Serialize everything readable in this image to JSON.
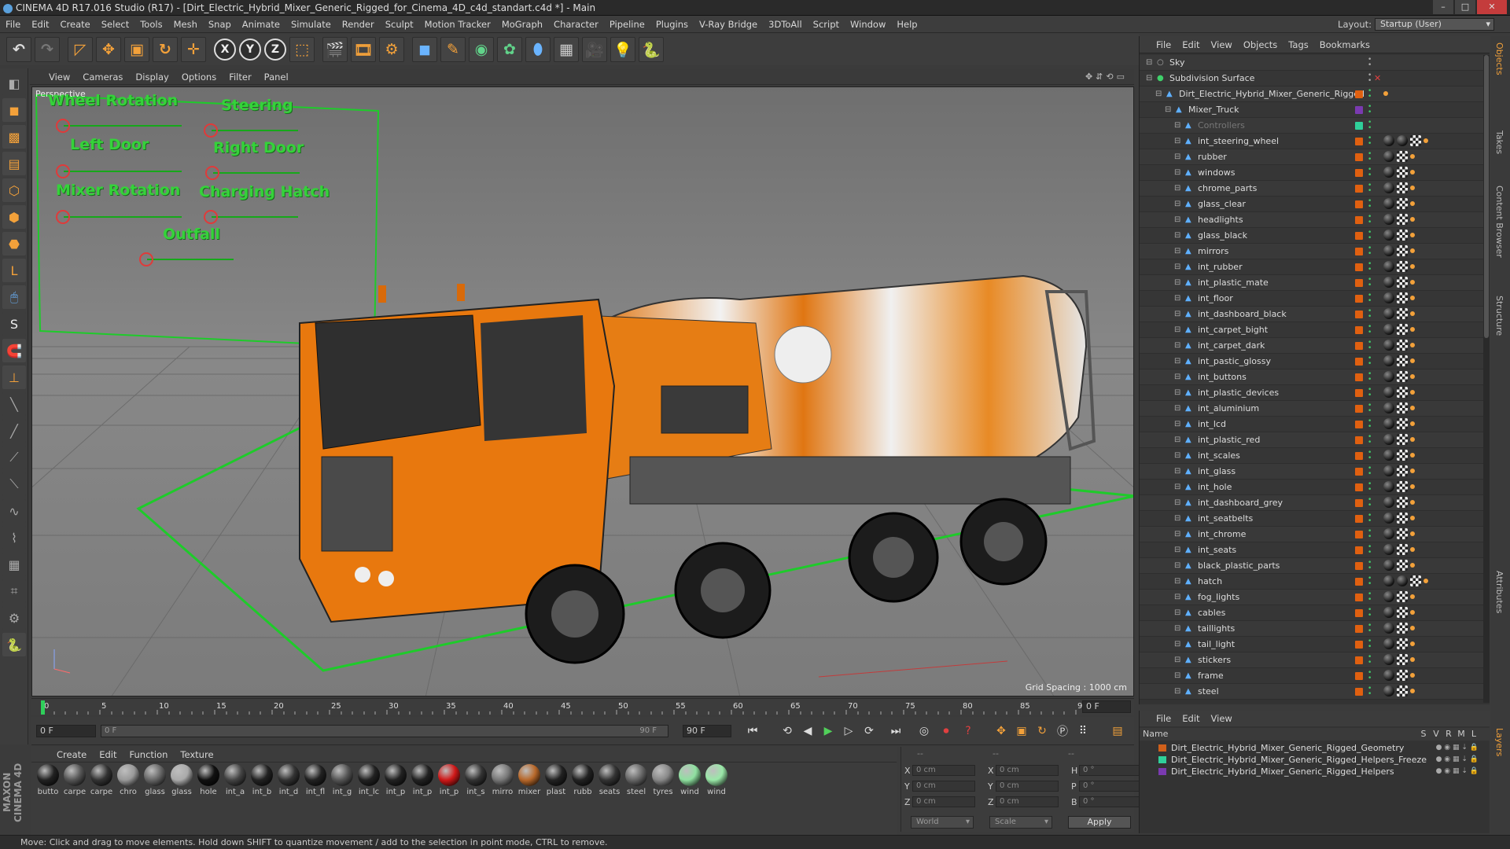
{
  "window": {
    "title": "CINEMA 4D R17.016 Studio (R17) - [Dirt_Electric_Hybrid_Mixer_Generic_Rigged_for_Cinema_4D_c4d_standart.c4d *] - Main"
  },
  "menu": [
    "File",
    "Edit",
    "Create",
    "Select",
    "Tools",
    "Mesh",
    "Snap",
    "Animate",
    "Simulate",
    "Render",
    "Sculpt",
    "Motion Tracker",
    "MoGraph",
    "Character",
    "Pipeline",
    "Plugins",
    "V-Ray Bridge",
    "3DToAll",
    "Script",
    "Window",
    "Help"
  ],
  "layout": {
    "label": "Layout:",
    "value": "Startup (User)"
  },
  "viewport": {
    "menu": [
      "View",
      "Cameras",
      "Display",
      "Options",
      "Filter",
      "Panel"
    ],
    "label": "Perspective",
    "grid_spacing": "Grid Spacing : 1000 cm",
    "controls": [
      "Wheel Rotation",
      "Steering",
      "Left Door",
      "Right Door",
      "Mixer Rotation",
      "Charging Hatch",
      "Outfall"
    ]
  },
  "timeline": {
    "ticks": [
      "0",
      "5",
      "10",
      "15",
      "20",
      "25",
      "30",
      "35",
      "40",
      "45",
      "50",
      "55",
      "60",
      "65",
      "70",
      "75",
      "80",
      "85",
      "90"
    ],
    "current_frame": "0 F",
    "start": "0 F",
    "range_start": "0 F",
    "range_end": "90 F",
    "end": "90 F"
  },
  "materials": {
    "menu": [
      "Create",
      "Edit",
      "Function",
      "Texture"
    ],
    "items": [
      {
        "name": "butto",
        "color": "#222"
      },
      {
        "name": "carpe",
        "color": "#555"
      },
      {
        "name": "carpe",
        "color": "#333"
      },
      {
        "name": "chro",
        "color": "#999"
      },
      {
        "name": "glass",
        "color": "#666"
      },
      {
        "name": "glass",
        "color": "#aaa"
      },
      {
        "name": "hole",
        "color": "#111"
      },
      {
        "name": "int_a",
        "color": "#444"
      },
      {
        "name": "int_b",
        "color": "#222"
      },
      {
        "name": "int_d",
        "color": "#333"
      },
      {
        "name": "int_fl",
        "color": "#222"
      },
      {
        "name": "int_g",
        "color": "#555"
      },
      {
        "name": "int_lc",
        "color": "#222"
      },
      {
        "name": "int_p",
        "color": "#222"
      },
      {
        "name": "int_p",
        "color": "#222"
      },
      {
        "name": "int_p",
        "color": "#d01818"
      },
      {
        "name": "int_s",
        "color": "#333"
      },
      {
        "name": "mirro",
        "color": "#777"
      },
      {
        "name": "mixer",
        "color": "#b8682a"
      },
      {
        "name": "plast",
        "color": "#222"
      },
      {
        "name": "rubb",
        "color": "#222"
      },
      {
        "name": "seats",
        "color": "#333"
      },
      {
        "name": "steel",
        "color": "#666"
      },
      {
        "name": "tyres",
        "color": "#888"
      },
      {
        "name": "wind",
        "color": "#8fe0a0"
      },
      {
        "name": "wind",
        "color": "#9ae8a8"
      }
    ]
  },
  "coords": {
    "headers": [
      "--",
      "--",
      "--"
    ],
    "rows": [
      {
        "a": "X",
        "v1": "0 cm",
        "b": "X",
        "v2": "0 cm",
        "c": "H",
        "v3": "0 °"
      },
      {
        "a": "Y",
        "v1": "0 cm",
        "b": "Y",
        "v2": "0 cm",
        "c": "P",
        "v3": "0 °"
      },
      {
        "a": "Z",
        "v1": "0 cm",
        "b": "Z",
        "v2": "0 cm",
        "c": "B",
        "v3": "0 °"
      }
    ],
    "world": "World",
    "scale": "Scale",
    "apply": "Apply"
  },
  "objects": {
    "menu": [
      "File",
      "Edit",
      "View",
      "Objects",
      "Tags",
      "Bookmarks"
    ],
    "rows": [
      {
        "name": "Sky",
        "indent": 0,
        "tags": []
      },
      {
        "name": "Subdivision Surface",
        "indent": 0,
        "tags": []
      },
      {
        "name": "Dirt_Electric_Hybrid_Mixer_Generic_Rigged",
        "indent": 1,
        "tags": [
          "dot"
        ]
      },
      {
        "name": "Mixer_Truck",
        "indent": 2,
        "tags": []
      },
      {
        "name": "Controllers",
        "indent": 3,
        "tags": []
      },
      {
        "name": "int_steering_wheel",
        "indent": 3,
        "tags": [
          "s",
          "s",
          "check",
          "dot"
        ]
      },
      {
        "name": "rubber",
        "indent": 3,
        "tags": [
          "s",
          "check",
          "dot"
        ]
      },
      {
        "name": "windows",
        "indent": 3,
        "tags": [
          "s",
          "check",
          "dot"
        ]
      },
      {
        "name": "chrome_parts",
        "indent": 3,
        "tags": [
          "s",
          "check",
          "dot"
        ]
      },
      {
        "name": "glass_clear",
        "indent": 3,
        "tags": [
          "s",
          "check",
          "dot"
        ]
      },
      {
        "name": "headlights",
        "indent": 3,
        "tags": [
          "s",
          "check",
          "dot"
        ]
      },
      {
        "name": "glass_black",
        "indent": 3,
        "tags": [
          "s",
          "check",
          "dot"
        ]
      },
      {
        "name": "mirrors",
        "indent": 3,
        "tags": [
          "s",
          "check",
          "dot"
        ]
      },
      {
        "name": "int_rubber",
        "indent": 3,
        "tags": [
          "s",
          "check",
          "dot"
        ]
      },
      {
        "name": "int_plastic_mate",
        "indent": 3,
        "tags": [
          "s",
          "check",
          "dot"
        ]
      },
      {
        "name": "int_floor",
        "indent": 3,
        "tags": [
          "s",
          "check",
          "dot"
        ]
      },
      {
        "name": "int_dashboard_black",
        "indent": 3,
        "tags": [
          "s",
          "check",
          "dot"
        ]
      },
      {
        "name": "int_carpet_bight",
        "indent": 3,
        "tags": [
          "s",
          "check",
          "dot"
        ]
      },
      {
        "name": "int_carpet_dark",
        "indent": 3,
        "tags": [
          "s",
          "check",
          "dot"
        ]
      },
      {
        "name": "int_pastic_glossy",
        "indent": 3,
        "tags": [
          "s",
          "check",
          "dot"
        ]
      },
      {
        "name": "int_buttons",
        "indent": 3,
        "tags": [
          "s",
          "check",
          "dot"
        ]
      },
      {
        "name": "int_plastic_devices",
        "indent": 3,
        "tags": [
          "s",
          "check",
          "dot"
        ]
      },
      {
        "name": "int_aluminium",
        "indent": 3,
        "tags": [
          "s",
          "check",
          "dot"
        ]
      },
      {
        "name": "int_lcd",
        "indent": 3,
        "tags": [
          "s",
          "check",
          "dot"
        ]
      },
      {
        "name": "int_plastic_red",
        "indent": 3,
        "tags": [
          "s",
          "check",
          "dot"
        ]
      },
      {
        "name": "int_scales",
        "indent": 3,
        "tags": [
          "s",
          "check",
          "dot"
        ]
      },
      {
        "name": "int_glass",
        "indent": 3,
        "tags": [
          "s",
          "check",
          "dot"
        ]
      },
      {
        "name": "int_hole",
        "indent": 3,
        "tags": [
          "s",
          "check",
          "dot"
        ]
      },
      {
        "name": "int_dashboard_grey",
        "indent": 3,
        "tags": [
          "s",
          "check",
          "dot"
        ]
      },
      {
        "name": "int_seatbelts",
        "indent": 3,
        "tags": [
          "s",
          "check",
          "dot"
        ]
      },
      {
        "name": "int_chrome",
        "indent": 3,
        "tags": [
          "s",
          "check",
          "dot"
        ]
      },
      {
        "name": "int_seats",
        "indent": 3,
        "tags": [
          "s",
          "check",
          "dot"
        ]
      },
      {
        "name": "black_plastic_parts",
        "indent": 3,
        "tags": [
          "s",
          "check",
          "dot"
        ]
      },
      {
        "name": "hatch",
        "indent": 3,
        "tags": [
          "s",
          "s",
          "check",
          "dot"
        ]
      },
      {
        "name": "fog_lights",
        "indent": 3,
        "tags": [
          "s",
          "check",
          "dot"
        ]
      },
      {
        "name": "cables",
        "indent": 3,
        "tags": [
          "s",
          "check",
          "dot"
        ]
      },
      {
        "name": "taillights",
        "indent": 3,
        "tags": [
          "s",
          "check",
          "dot"
        ]
      },
      {
        "name": "tail_light",
        "indent": 3,
        "tags": [
          "s",
          "check",
          "dot"
        ]
      },
      {
        "name": "stickers",
        "indent": 3,
        "tags": [
          "s",
          "check",
          "dot"
        ]
      },
      {
        "name": "frame",
        "indent": 3,
        "tags": [
          "s",
          "check",
          "dot"
        ]
      },
      {
        "name": "steel",
        "indent": 3,
        "tags": [
          "s",
          "check",
          "dot"
        ]
      }
    ]
  },
  "layers": {
    "menu": [
      "File",
      "Edit",
      "View"
    ],
    "name_header": "Name",
    "cols": [
      "S",
      "V",
      "R",
      "M",
      "L"
    ],
    "rows": [
      {
        "name": "Dirt_Electric_Hybrid_Mixer_Generic_Rigged_Geometry",
        "color": "#d0601a"
      },
      {
        "name": "Dirt_Electric_Hybrid_Mixer_Generic_Rigged_Helpers_Freeze",
        "color": "#2fd09a"
      },
      {
        "name": "Dirt_Electric_Hybrid_Mixer_Generic_Rigged_Helpers",
        "color": "#7a3ab0"
      }
    ]
  },
  "right_tabs": [
    "Objects",
    "Takes",
    "Content Browser",
    "Structure",
    "Attributes",
    "Layers"
  ],
  "status": "Move: Click and drag to move elements. Hold down SHIFT to quantize movement / add to the selection in point mode, CTRL to remove."
}
